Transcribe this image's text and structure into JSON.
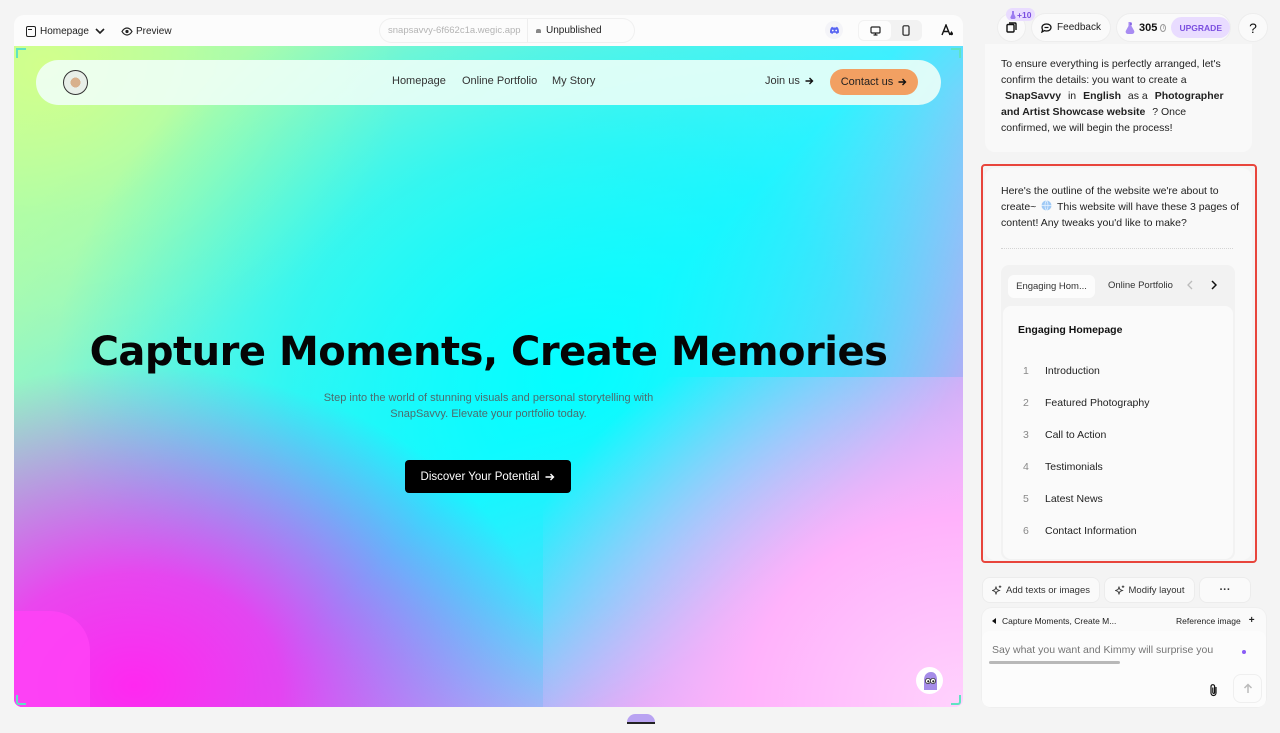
{
  "toolbar": {
    "page_selector": "Homepage",
    "preview_label": "Preview",
    "site_url": "snapsavvy-6f662c1a.wegic.app",
    "publish_status": "Unpublished"
  },
  "site": {
    "nav": {
      "links": [
        "Homepage",
        "Online Portfolio",
        "My Story"
      ],
      "join_label": "Join us",
      "contact_label": "Contact us"
    },
    "hero": {
      "title": "Capture Moments, Create Memories",
      "subtitle_line1": "Step into the world of stunning visuals and personal storytelling with",
      "subtitle_line2": "SnapSavvy. Elevate your portfolio today.",
      "cta_label": "Discover Your Potential"
    }
  },
  "topbar": {
    "credit_bonus": "+10",
    "feedback_label": "Feedback",
    "credits": "305",
    "upgrade_label": "UPGRADE",
    "help_label": "?"
  },
  "chat": {
    "confirm_message": {
      "part1": "To ensure everything is perfectly arranged, let's confirm the details: you want to create a",
      "name": "SnapSavvy",
      "part2": "in",
      "language": "English",
      "part3": "as a",
      "type": "Photographer and Artist Showcase website",
      "part4": "? Once confirmed, we will begin the process!"
    },
    "outline_message": {
      "text_before_icon": "Here's the outline of the website we're about to create~",
      "text_after_icon": "This website will have these 3 pages of content! Any tweaks you'd like to make?",
      "tabs": [
        "Engaging Hom...",
        "Online Portfolio"
      ],
      "active_page_title": "Engaging Homepage",
      "sections": [
        {
          "num": "1",
          "label": "Introduction"
        },
        {
          "num": "2",
          "label": "Featured Photography"
        },
        {
          "num": "3",
          "label": "Call to Action"
        },
        {
          "num": "4",
          "label": "Testimonials"
        },
        {
          "num": "5",
          "label": "Latest News"
        },
        {
          "num": "6",
          "label": "Contact Information"
        }
      ]
    }
  },
  "actions": {
    "add_texts_label": "Add texts or images",
    "modify_layout_label": "Modify layout",
    "more_label": "···"
  },
  "composer": {
    "context_label": "Capture Moments, Create M...",
    "reference_label": "Reference image",
    "reference_add": "+",
    "placeholder": "Say what you want and Kimmy will surprise you"
  },
  "colors": {
    "accent_orange": "#f2a062",
    "upgrade_purple": "#e9dcff",
    "upgrade_text": "#7b4fe0",
    "highlight_red": "#e8453c",
    "discord_blue": "#5865f2"
  }
}
